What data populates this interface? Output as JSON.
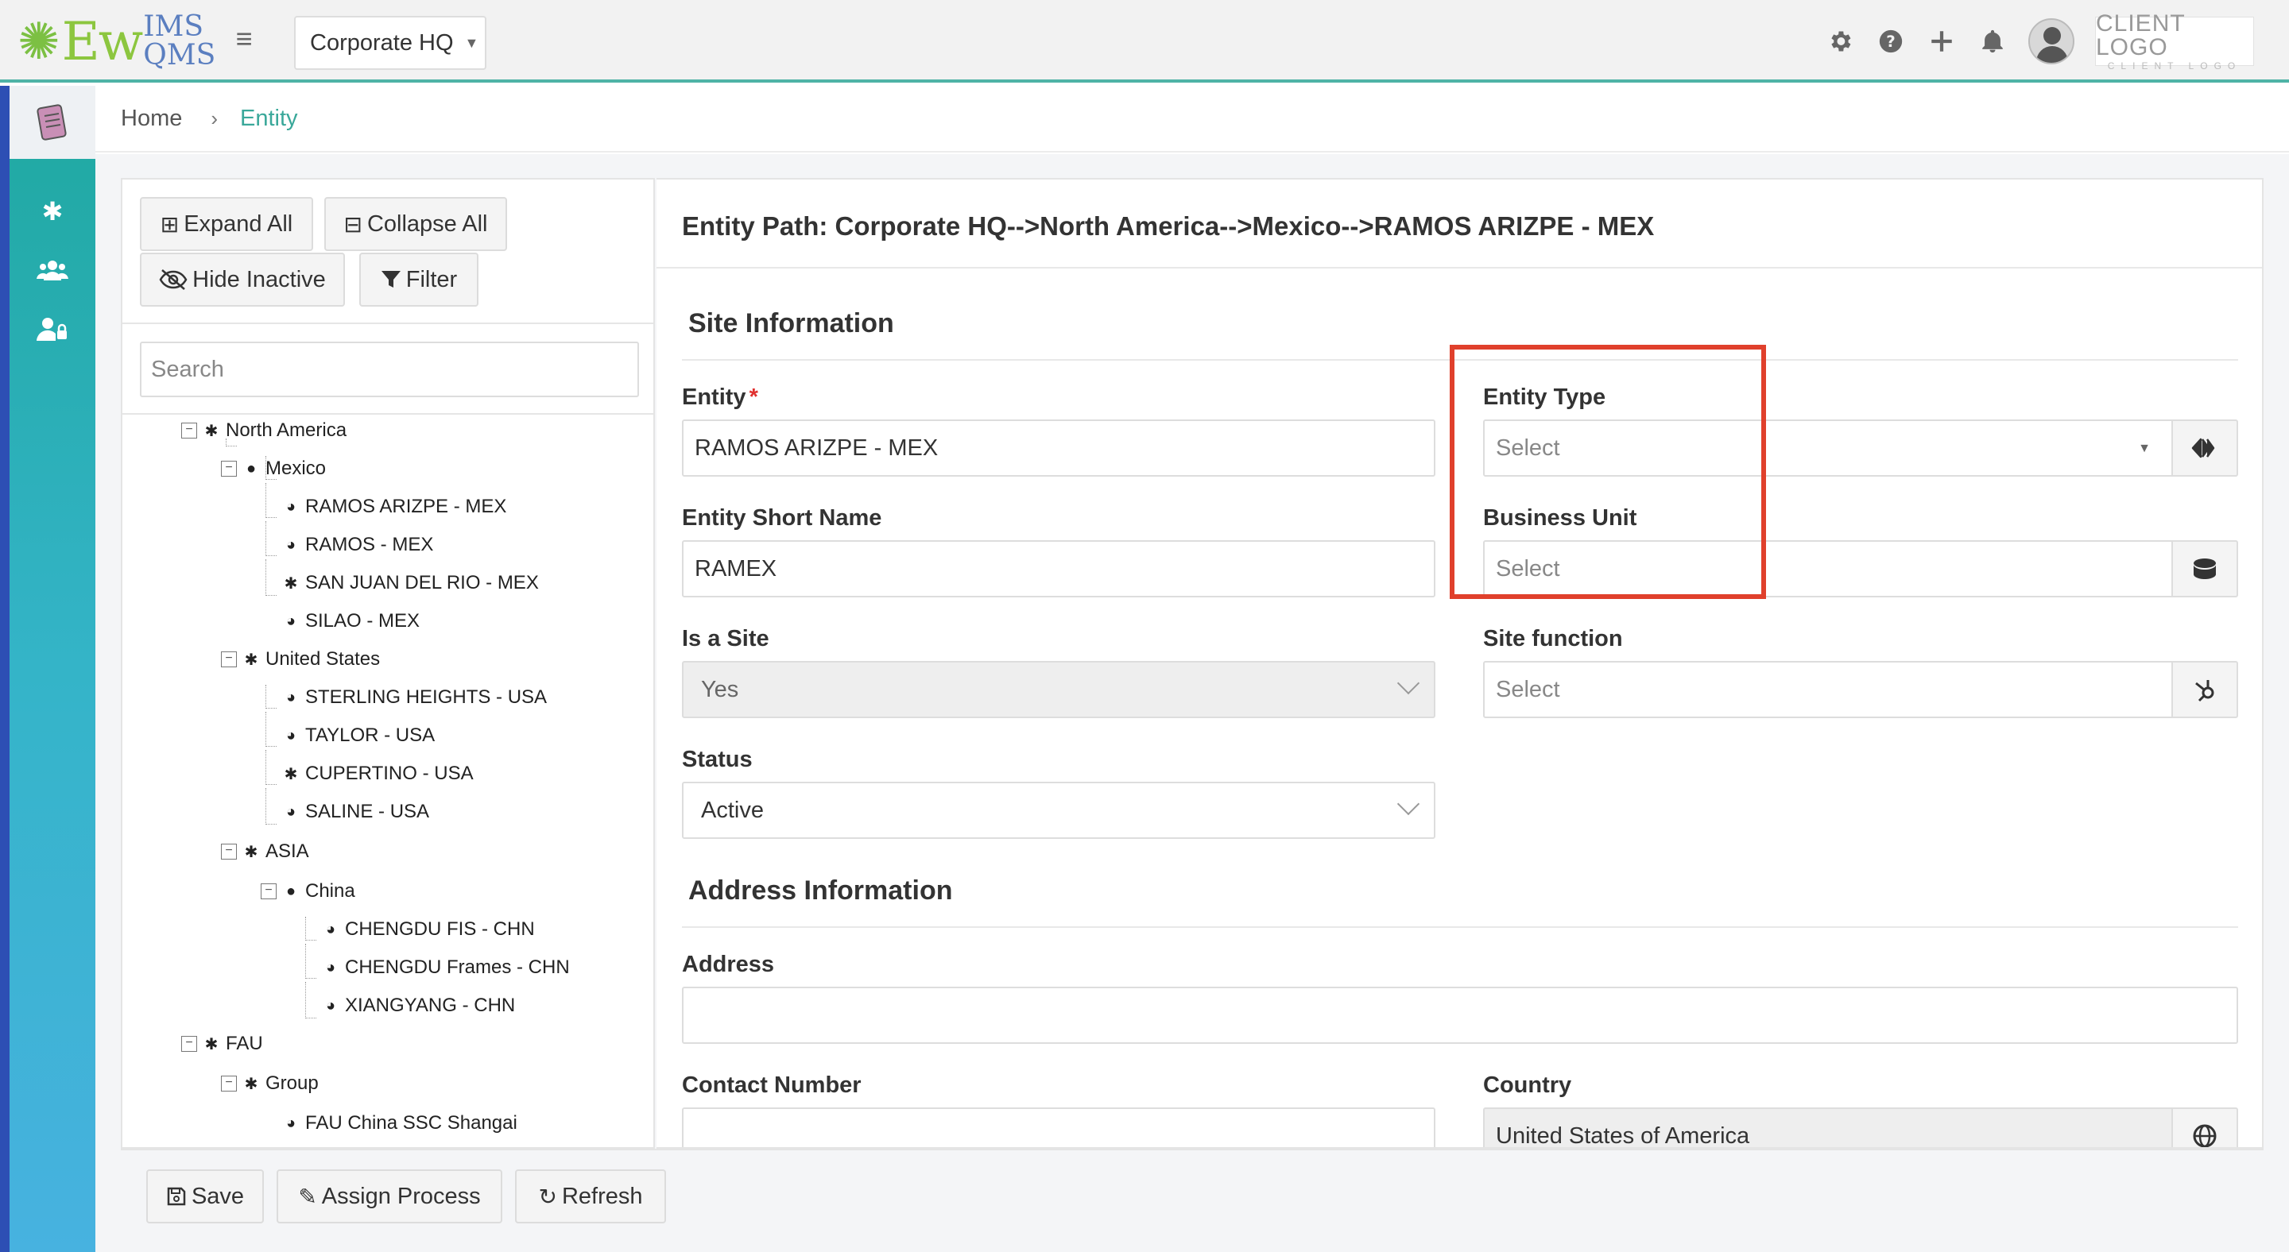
{
  "header": {
    "logo_main": "Ew",
    "logo_top": "IMS",
    "logo_bottom": "QMS",
    "org_selected": "Corporate HQ",
    "client_logo_title": "CLIENT LOGO",
    "client_logo_sub": "CLIENT LOGO",
    "icons": [
      "gear-icon",
      "help-icon",
      "plus-icon",
      "bell-icon",
      "avatar"
    ]
  },
  "leftnav": {
    "items": [
      "document-icon",
      "gear-icon",
      "users-icon",
      "user-lock-icon"
    ]
  },
  "breadcrumb": {
    "home": "Home",
    "separator": "›",
    "current": "Entity"
  },
  "tree_panel": {
    "expand_all": "Expand All",
    "collapse_all": "Collapse All",
    "hide_inactive": "Hide Inactive",
    "filter": "Filter",
    "search_placeholder": "Search",
    "nodes": [
      {
        "label": "North America",
        "icon": "gear"
      },
      {
        "label": "Mexico",
        "icon": "globe"
      },
      {
        "label": "RAMOS ARIZPE - MEX",
        "icon": "globe"
      },
      {
        "label": "RAMOS - MEX",
        "icon": "globe"
      },
      {
        "label": "SAN JUAN DEL RIO - MEX",
        "icon": "gear"
      },
      {
        "label": "SILAO - MEX",
        "icon": "globe"
      },
      {
        "label": "United States",
        "icon": "gear"
      },
      {
        "label": "STERLING HEIGHTS - USA",
        "icon": "globe"
      },
      {
        "label": "TAYLOR - USA",
        "icon": "globe"
      },
      {
        "label": "CUPERTINO - USA",
        "icon": "gear"
      },
      {
        "label": "SALINE - USA",
        "icon": "globe"
      },
      {
        "label": "ASIA",
        "icon": "gear"
      },
      {
        "label": "China",
        "icon": "globe"
      },
      {
        "label": "CHENGDU FIS - CHN",
        "icon": "globe"
      },
      {
        "label": "CHENGDU Frames - CHN",
        "icon": "globe"
      },
      {
        "label": "XIANGYANG - CHN",
        "icon": "globe"
      },
      {
        "label": "FAU",
        "icon": "gear"
      },
      {
        "label": "Group",
        "icon": "gear"
      },
      {
        "label": "FAU China SSC Shangai",
        "icon": "globe"
      }
    ]
  },
  "detail": {
    "path_title": "Entity Path: Corporate HQ-->North America-->Mexico-->RAMOS ARIZPE - MEX",
    "site_section": "Site Information",
    "entity_label": "Entity",
    "required_mark": "*",
    "entity_value": "RAMOS ARIZPE - MEX",
    "entity_type_label": "Entity Type",
    "entity_type_placeholder": "Select",
    "short_name_label": "Entity Short Name",
    "short_name_value": "RAMEX",
    "business_unit_label": "Business Unit",
    "business_unit_placeholder": "Select",
    "is_site_label": "Is a Site",
    "is_site_value": "Yes",
    "site_function_label": "Site function",
    "site_function_placeholder": "Select",
    "status_label": "Status",
    "status_value": "Active",
    "address_section": "Address Information",
    "address_label": "Address",
    "address_value": "",
    "contact_label": "Contact Number",
    "contact_value": "",
    "country_label": "Country",
    "country_value": "United States of America"
  },
  "footer": {
    "save": "Save",
    "assign_process": "Assign Process",
    "refresh": "Refresh"
  },
  "colors": {
    "accent": "#3aa89a",
    "highlight": "#e0402c",
    "nav_top": "#1fa8a0",
    "nav_bottom": "#47b2e0"
  }
}
